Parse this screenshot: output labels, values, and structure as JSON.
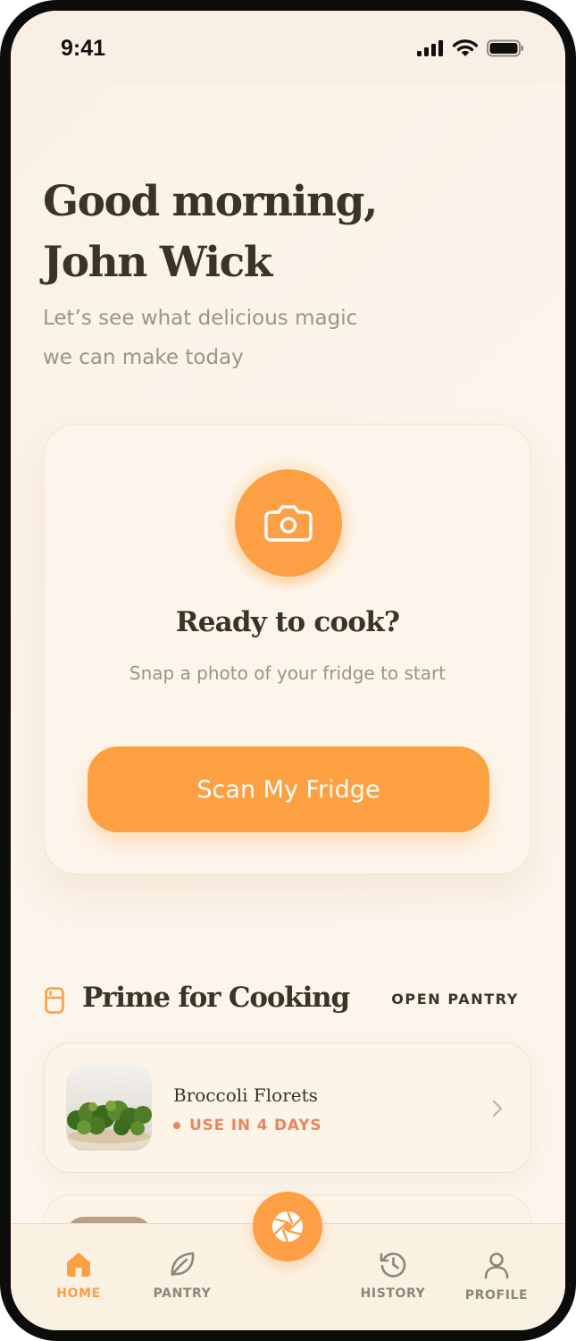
{
  "status_bar": {
    "time": "9:41",
    "icons": [
      "cellular-signal-icon",
      "wifi-icon",
      "battery-icon"
    ]
  },
  "greeting": {
    "line1": "Good morning,",
    "line2": "John Wick"
  },
  "subtitle": {
    "line1": "Let’s see what delicious magic",
    "line2": "we can make today"
  },
  "scan_card": {
    "icon": "camera-icon",
    "title": "Ready to cook?",
    "subtitle": "Snap a photo of your fridge to start",
    "button_label": "Scan My Fridge"
  },
  "prime_section": {
    "icon": "fridge-icon",
    "title": "Prime for Cooking",
    "link_label": "OPEN PANTRY",
    "items": [
      {
        "name": "Broccoli Florets",
        "status": "USE IN 4 DAYS",
        "thumbnail": "broccoli-photo"
      }
    ]
  },
  "tab_bar": {
    "tabs": [
      {
        "label": "HOME",
        "icon": "home-icon",
        "active": true
      },
      {
        "label": "PANTRY",
        "icon": "leaf-icon",
        "active": false
      },
      {
        "label": "HISTORY",
        "icon": "history-icon",
        "active": false
      },
      {
        "label": "PROFILE",
        "icon": "user-icon",
        "active": false
      }
    ],
    "center_action_icon": "aperture-icon"
  },
  "colors": {
    "accent": "#fc9f45",
    "background": "#fcf5ec",
    "text_primary": "#3d3128",
    "text_muted": "#a09282",
    "warning": "#e98661"
  }
}
